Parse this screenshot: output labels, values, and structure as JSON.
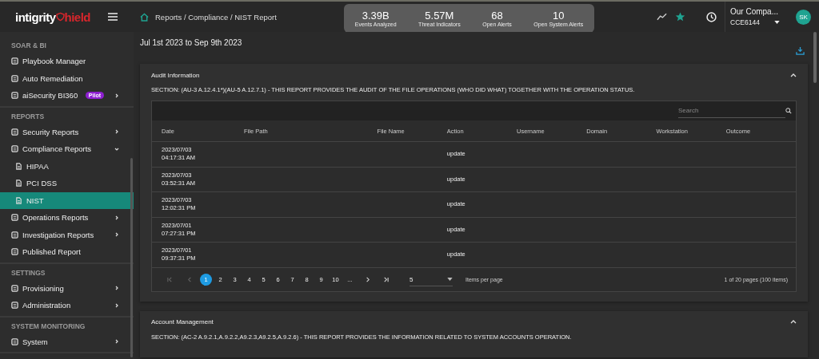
{
  "app": {
    "logo_left": "intigrity",
    "logo_right": "hield"
  },
  "breadcrumb": "Reports / Compliance / NIST Report",
  "stats": [
    {
      "value": "3.39B",
      "label": "Events Analyzed"
    },
    {
      "value": "5.57M",
      "label": "Threat Indicators"
    },
    {
      "value": "68",
      "label": "Open Alerts"
    },
    {
      "value": "10",
      "label": "Open System Alerts"
    }
  ],
  "account": {
    "company": "Our Compa...",
    "code": "CCE6144",
    "avatar": "SK"
  },
  "sidebar": {
    "sections": [
      {
        "title": "SOAR & BI",
        "items": [
          {
            "label": "Playbook Manager",
            "selected": false
          },
          {
            "label": "Auto Remediation",
            "selected": false
          },
          {
            "label": "aiSecurity BI360",
            "badge": "Pilot",
            "expanded": false,
            "selected": false
          }
        ]
      },
      {
        "title": "REPORTS",
        "items": [
          {
            "label": "Security Reports",
            "expanded": false,
            "selected": false
          },
          {
            "label": "Compliance Reports",
            "expanded": true,
            "selected": false,
            "children": [
              {
                "label": "HIPAA",
                "selected": false
              },
              {
                "label": "PCI DSS",
                "selected": false
              },
              {
                "label": "NIST",
                "selected": true
              }
            ]
          },
          {
            "label": "Operations Reports",
            "expanded": false,
            "selected": false
          },
          {
            "label": "Investigation Reports",
            "expanded": false,
            "selected": false
          },
          {
            "label": "Published Report",
            "selected": false
          }
        ]
      },
      {
        "title": "SETTINGS",
        "items": [
          {
            "label": "Provisioning",
            "expanded": false,
            "selected": false
          },
          {
            "label": "Administration",
            "expanded": false,
            "selected": false
          }
        ]
      },
      {
        "title": "SYSTEM MONITORING",
        "items": [
          {
            "label": "System",
            "expanded": false,
            "selected": false
          }
        ]
      }
    ]
  },
  "date_range": "Jul 1st 2023 to Sep 9th 2023",
  "cards": [
    {
      "title": "Audit Information",
      "expanded": true,
      "section": "SECTION: (AU-3 A.12.4.1*)(AU-5 A.12.7.1) - THIS REPORT PROVIDES THE AUDIT OF THE FILE OPERATIONS (WHO DID WHAT) TOGETHER WITH THE OPERATION STATUS.",
      "table": {
        "search": {
          "placeholder": "Search"
        },
        "columns": [
          "Date",
          "File Path",
          "File Name",
          "Action",
          "Username",
          "Domain",
          "Workstation",
          "Outcome"
        ],
        "rows": [
          [
            "2023/07/03\n04:17:31 AM",
            "",
            "",
            "update",
            "",
            "",
            "",
            ""
          ],
          [
            "2023/07/03\n03:52:31 AM",
            "",
            "",
            "update",
            "",
            "",
            "",
            ""
          ],
          [
            "2023/07/03\n12:02:31 PM",
            "",
            "",
            "update",
            "",
            "",
            "",
            ""
          ],
          [
            "2023/07/01\n07:27:31 PM",
            "",
            "",
            "update",
            "",
            "",
            "",
            ""
          ],
          [
            "2023/07/01\n09:37:31 PM",
            "",
            "",
            "update",
            "",
            "",
            "",
            ""
          ]
        ],
        "pages": [
          {
            "label": "1",
            "selected": true
          },
          {
            "label": "2",
            "selected": false
          },
          {
            "label": "3",
            "selected": false
          },
          {
            "label": "4",
            "selected": false
          },
          {
            "label": "5",
            "selected": false
          },
          {
            "label": "6",
            "selected": false
          },
          {
            "label": "7",
            "selected": false
          },
          {
            "label": "8",
            "selected": false
          },
          {
            "label": "9",
            "selected": false
          },
          {
            "label": "10",
            "selected": false
          },
          {
            "label": "...",
            "selected": false
          }
        ],
        "page_size": "5",
        "page_size_label": "Items per page",
        "summary": "1 of 20 pages (100 items)"
      }
    },
    {
      "title": "Account Management",
      "expanded": true,
      "section": "SECTION: (AC-2 A.9.2.1,A.9.2.2,A9.2.3,A9.2.5,A.9.2.6) - THIS REPORT PROVIDES THE INFORMATION RELATED TO SYSTEM ACCOUNTS OPERATION."
    }
  ]
}
